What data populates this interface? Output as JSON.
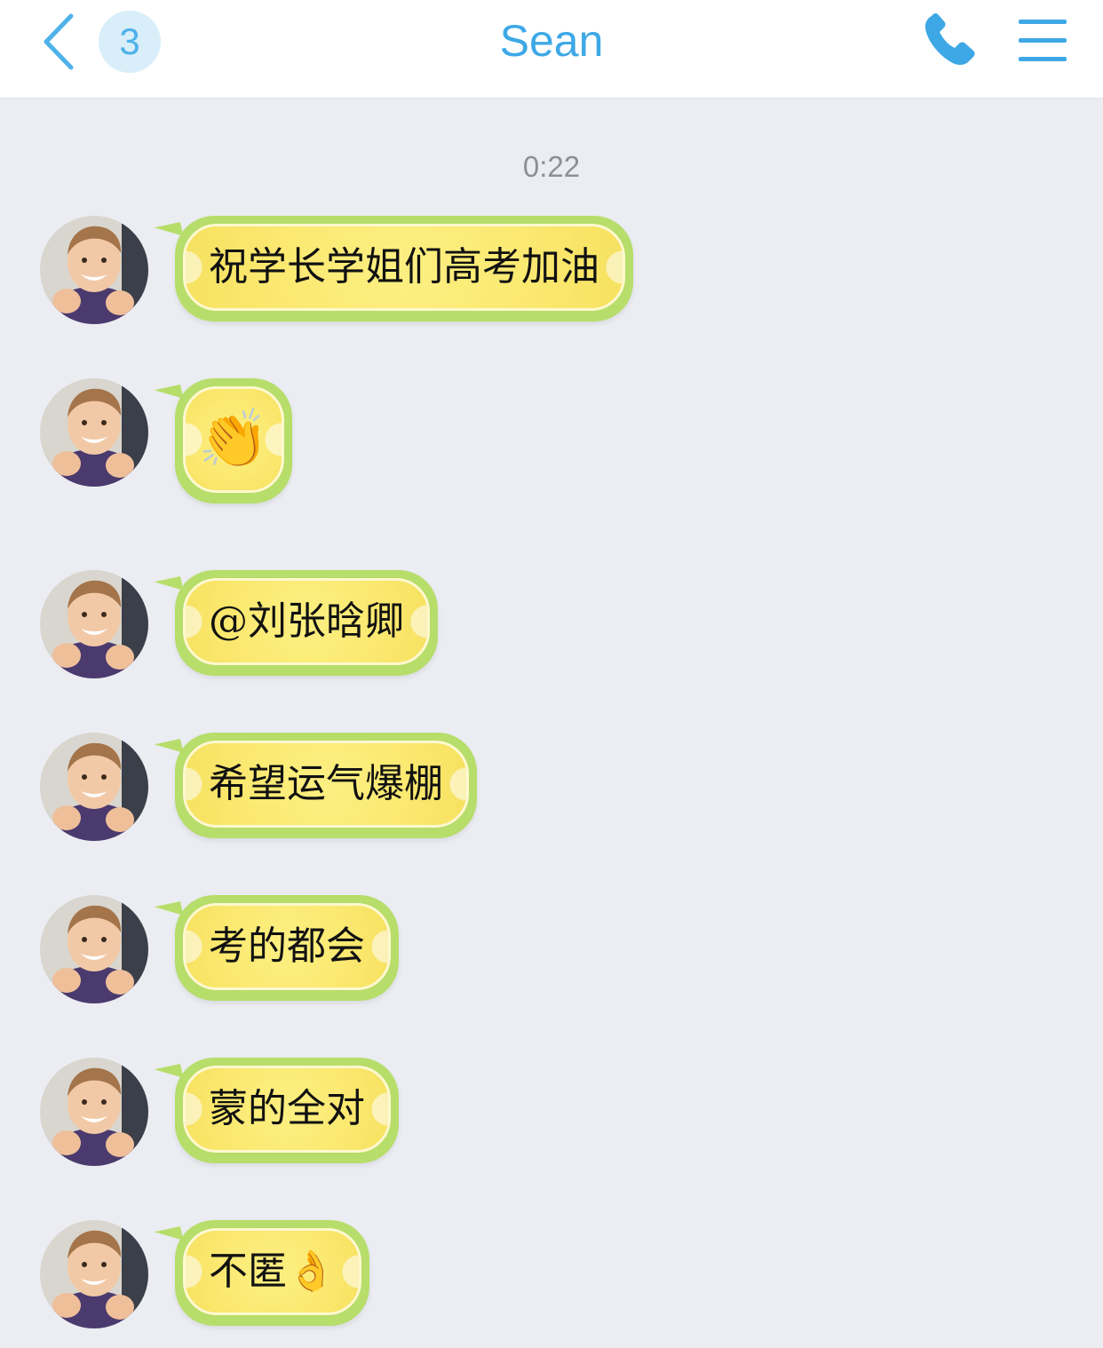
{
  "header": {
    "back_icon": "chevron-left-icon",
    "unread_count": "3",
    "title": "Sean",
    "call_icon": "phone-icon",
    "menu_icon": "hamburger-menu-icon",
    "accent_color": "#3ea8e6"
  },
  "chat": {
    "timestamp": "0:22",
    "bubble_color": "#fbe971",
    "bubble_border_color": "#b7dd6a",
    "messages": [
      {
        "text": "祝学长学姐们高考加油"
      },
      {
        "text": "👏"
      },
      {
        "text": "@刘张晗卿"
      },
      {
        "text": "希望运气爆棚"
      },
      {
        "text": "考的都会"
      },
      {
        "text": "蒙的全对"
      },
      {
        "text": "不匿👌"
      }
    ]
  }
}
